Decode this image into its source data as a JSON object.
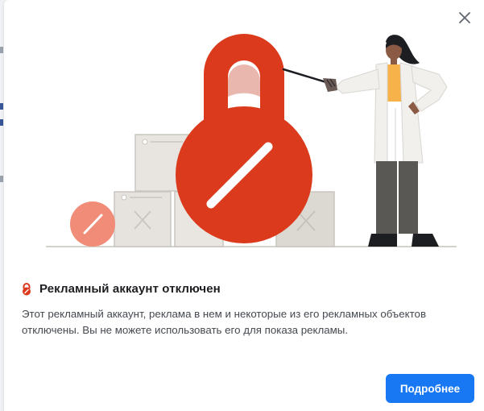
{
  "dialog": {
    "title": "Рекламный аккаунт отключен",
    "body": "Этот рекламный аккаунт, реклама в нем и некоторые из его рекламных объектов отключены. Вы не можете использовать его для показа рекламы.",
    "primary_button_label": "Подробнее",
    "close_icon": "close-icon",
    "title_icon": "lock-icon"
  },
  "colors": {
    "accent": "#1877f2",
    "lock_red": "#dc3a1d",
    "lock_red_dark": "#c2321a",
    "salmon": "#f08c78"
  }
}
